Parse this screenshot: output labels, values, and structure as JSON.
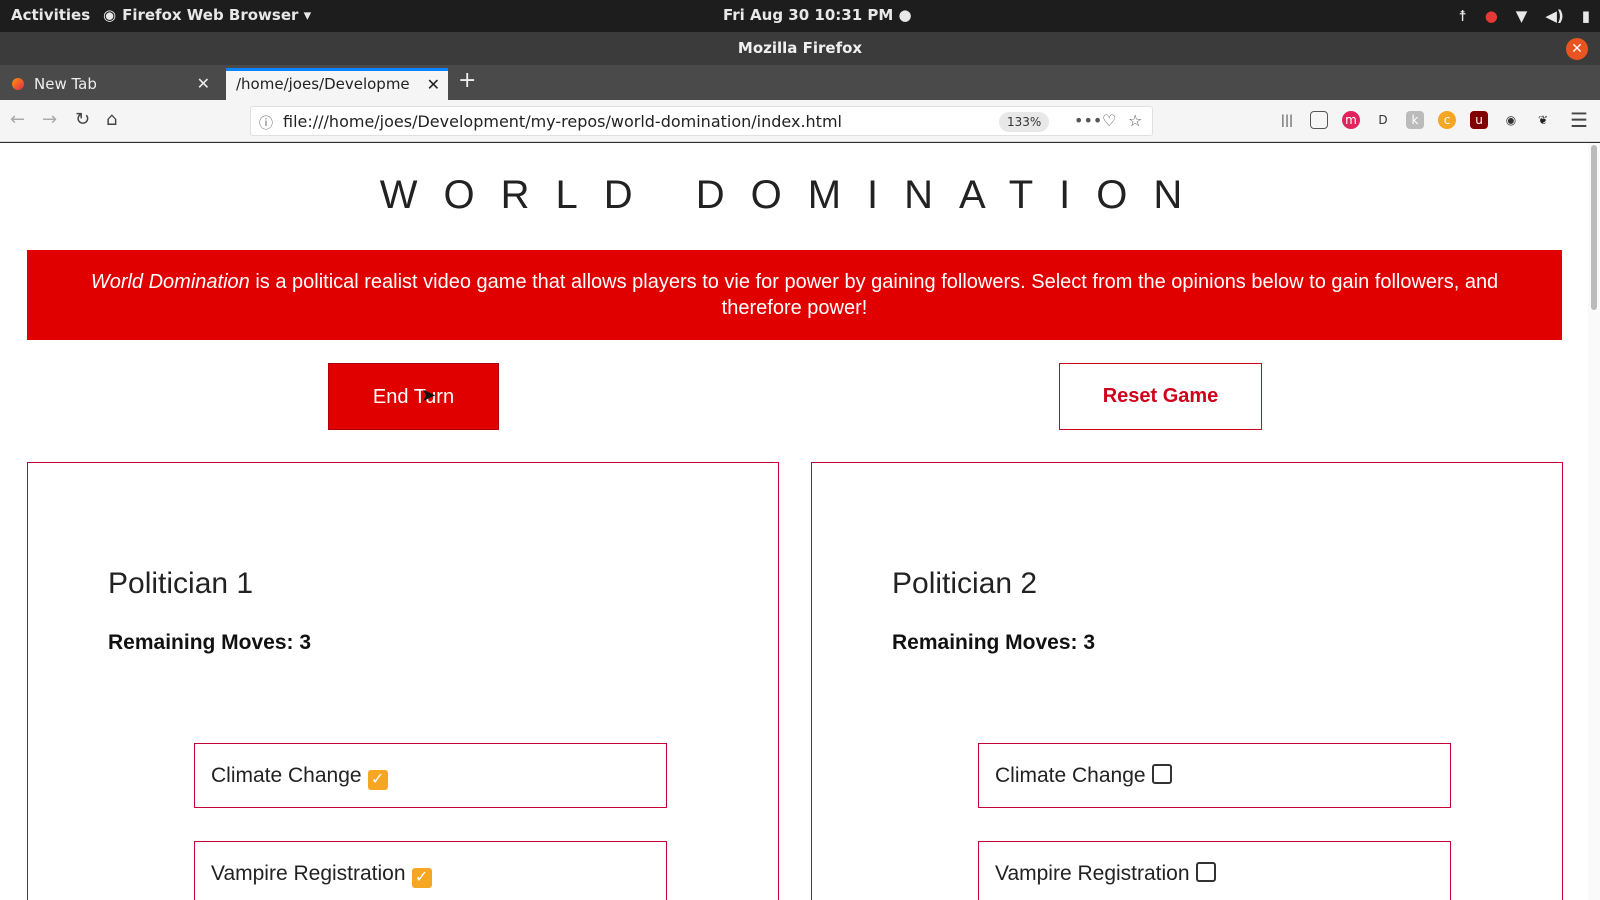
{
  "system": {
    "activities": "Activities",
    "app_menu": "Firefox Web Browser ▾",
    "clock": "Fri Aug 30  10:31 PM ●"
  },
  "window": {
    "title": "Mozilla Firefox"
  },
  "tabs": [
    {
      "label": "New Tab"
    },
    {
      "label": "/home/joes/Developme"
    }
  ],
  "navbar": {
    "url": "file:///home/joes/Development/my-repos/world-domination/index.html",
    "zoom": "133%"
  },
  "page": {
    "title": "WORLD DOMINATION",
    "intro_italic": "World Domination",
    "intro_rest": " is a political realist video game that allows players to vie for power by gaining followers. Select from the opinions below to gain followers, and therefore power!",
    "end_turn": "End Turn",
    "reset_game": "Reset Game",
    "politicians": [
      {
        "name": "Politician 1",
        "moves": "Remaining Moves: 3",
        "opinions": [
          {
            "label": "Climate Change",
            "checked": true
          },
          {
            "label": "Vampire Registration",
            "checked": true
          }
        ]
      },
      {
        "name": "Politician 2",
        "moves": "Remaining Moves: 3",
        "opinions": [
          {
            "label": "Climate Change",
            "checked": false
          },
          {
            "label": "Vampire Registration",
            "checked": false
          }
        ]
      }
    ]
  },
  "colors": {
    "accent": "#e00000",
    "border": "#c4003a",
    "check": "#f5a623"
  }
}
